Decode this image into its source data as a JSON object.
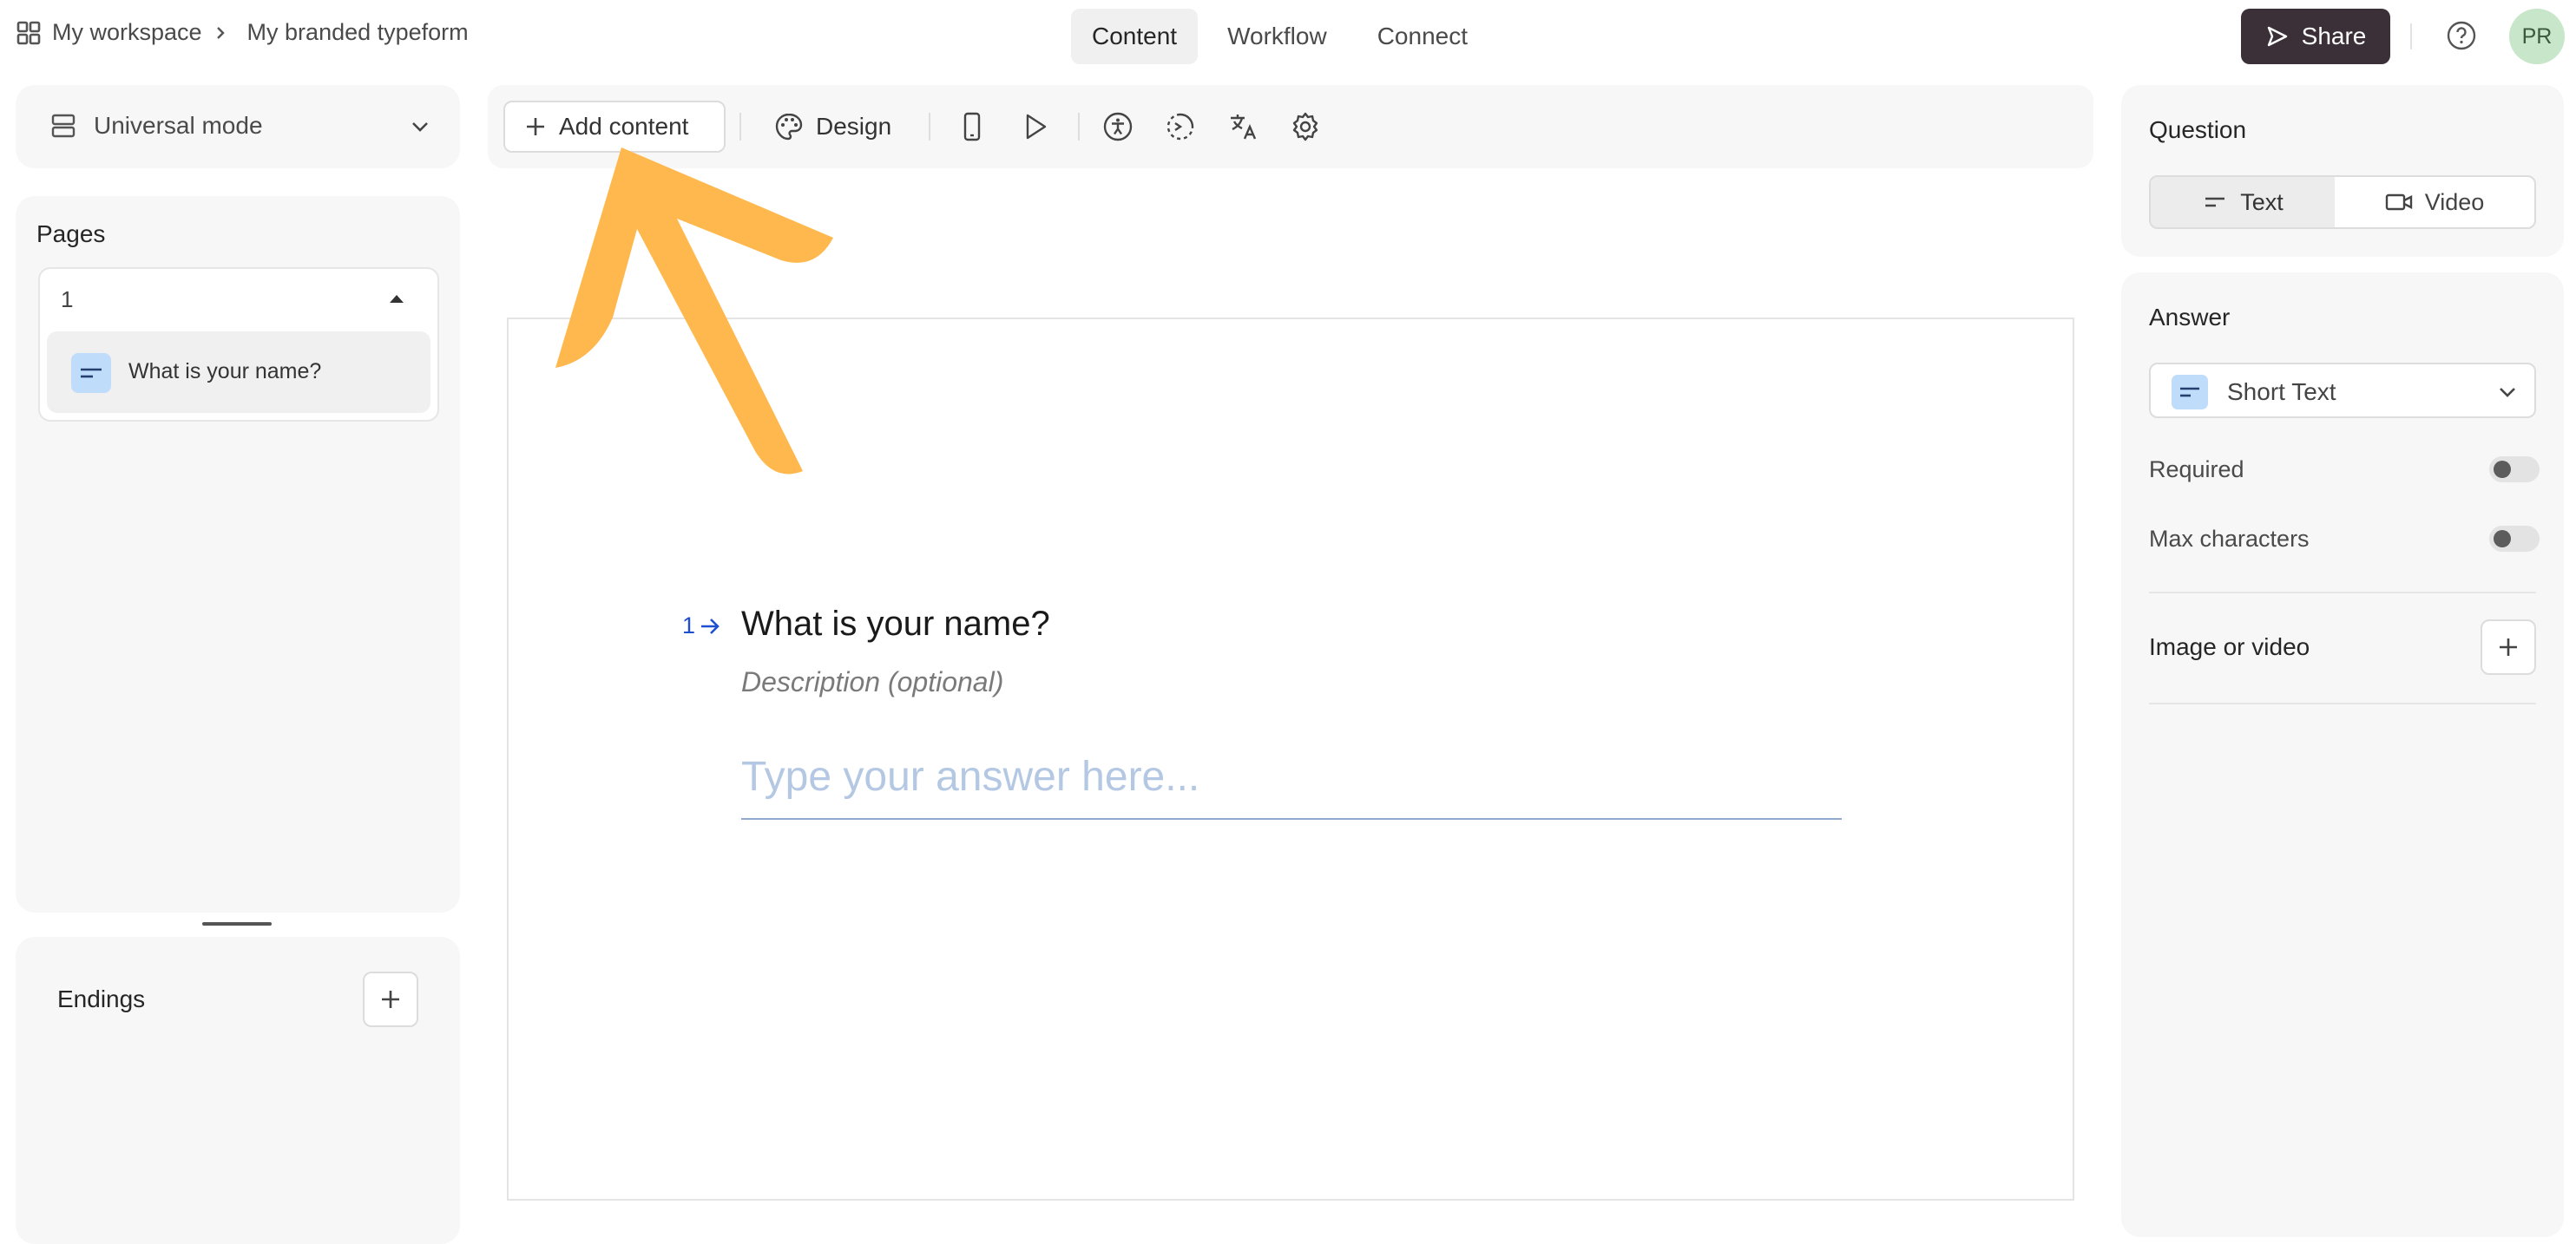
{
  "breadcrumb": {
    "workspace": "My workspace",
    "form": "My branded typeform"
  },
  "nav": {
    "tabs": [
      "Content",
      "Workflow",
      "Connect"
    ]
  },
  "header": {
    "share_label": "Share",
    "avatar_initials": "PR"
  },
  "sidebar": {
    "mode_label": "Universal mode",
    "pages_title": "Pages",
    "page_group": "1",
    "items": [
      {
        "label": "What is your name?"
      }
    ],
    "endings_title": "Endings"
  },
  "toolbar": {
    "add_content": "Add content",
    "design": "Design"
  },
  "form": {
    "number": "1",
    "question": "What is your name?",
    "description": "Description (optional)",
    "answer_placeholder": "Type your answer here..."
  },
  "settings": {
    "question_title": "Question",
    "text_label": "Text",
    "video_label": "Video",
    "answer_title": "Answer",
    "answer_type": "Short Text",
    "required_label": "Required",
    "max_chars_label": "Max characters",
    "image_video_label": "Image or video"
  },
  "colors": {
    "accent_arrow": "#ffb84d",
    "share_bg": "#3b2f38",
    "question_number": "#1f4fd1",
    "placeholder": "#b4c8e4",
    "type_icon_bg": "#bfdcfb"
  }
}
